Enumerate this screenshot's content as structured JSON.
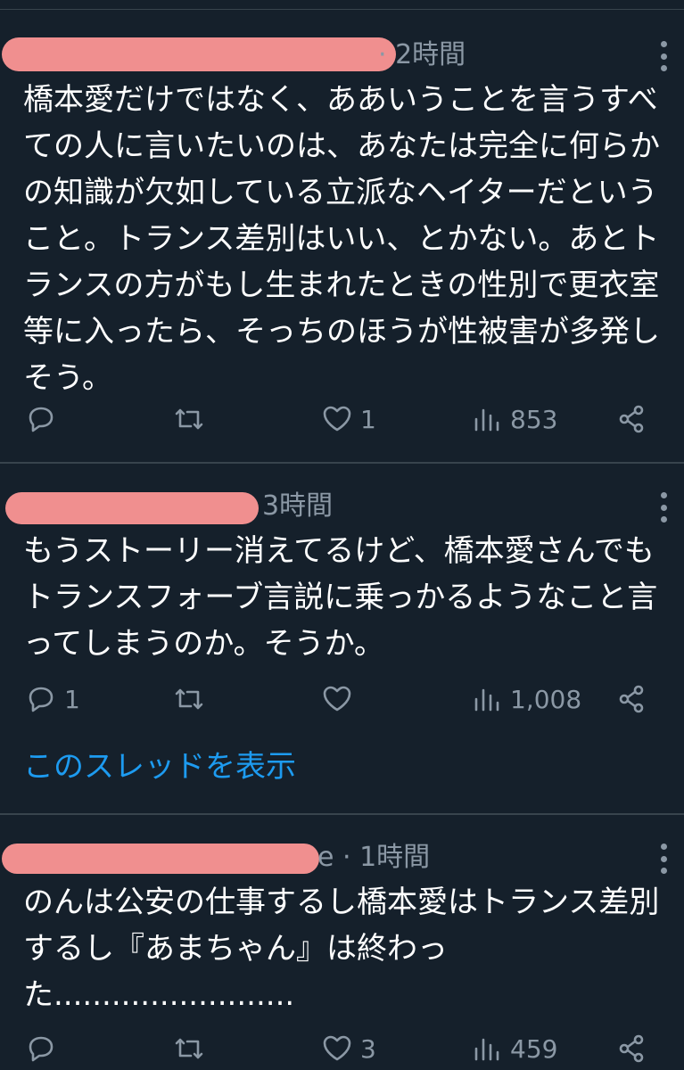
{
  "tweets": [
    {
      "time": "· 2時間",
      "text": "橋本愛だけではなく、ああいうことを言うすべての人に言いたいのは、あなたは完全に何らかの知識が欠如している立派なヘイターだということ。トランス差別はいい、とかない。あとトランスの方がもし生まれたときの性別で更衣室等に入ったら、そっちのほうが性被害が多発しそう。",
      "replies": "",
      "retweets": "",
      "likes": "1",
      "views": "853"
    },
    {
      "time": "3時間",
      "text": "もうストーリー消えてるけど、橋本愛さんでもトランスフォーブ言説に乗っかるようなこと言ってしまうのか。そうか。",
      "replies": "1",
      "retweets": "",
      "likes": "",
      "views": "1,008",
      "thread_link": "このスレッドを表示"
    },
    {
      "time": "e · 1時間",
      "text": "のんは公安の仕事するし橋本愛はトランス差別するし『あまちゃん』は終わった.........................",
      "replies": "",
      "retweets": "",
      "likes": "3",
      "views": "459"
    }
  ],
  "icons": {
    "reply": "reply-icon",
    "retweet": "retweet-icon",
    "like": "heart-icon",
    "views": "views-icon",
    "share": "share-icon",
    "more": "more-icon"
  },
  "colors": {
    "background": "#15202b",
    "text": "#ffffff",
    "secondary": "#8b98a5",
    "link": "#1d9bf0",
    "redaction": "#f08f8f"
  }
}
